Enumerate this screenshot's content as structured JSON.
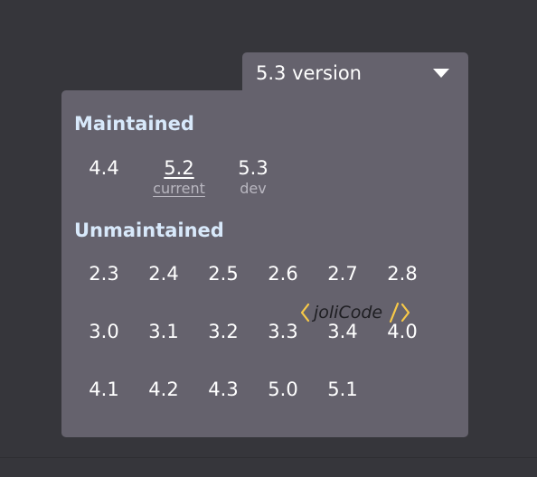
{
  "version_selector": {
    "label": "5.3 version",
    "caret_icon": "caret-down-icon"
  },
  "maintained": {
    "title": "Maintained",
    "versions": [
      {
        "number": "4.4",
        "note": ""
      },
      {
        "number": "5.2",
        "note": "current"
      },
      {
        "number": "5.3",
        "note": "dev"
      }
    ]
  },
  "unmaintained": {
    "title": "Unmaintained",
    "rows": [
      [
        "2.3",
        "2.4",
        "2.5",
        "2.6",
        "2.7",
        "2.8"
      ],
      [
        "3.0",
        "3.1",
        "3.2",
        "3.3",
        "3.4",
        "4.0"
      ],
      [
        "4.1",
        "4.2",
        "4.3",
        "5.0",
        "5.1"
      ]
    ]
  },
  "sponsor_logo": {
    "name": "joliCode-logo",
    "text": "joliCode",
    "accent_color": "#f7c948"
  },
  "colors": {
    "background": "#36363b",
    "panel": "#65626d",
    "section_title": "#d8e9fb",
    "version_text": "#ffffff",
    "secondary_text": "#b9b7c0"
  }
}
